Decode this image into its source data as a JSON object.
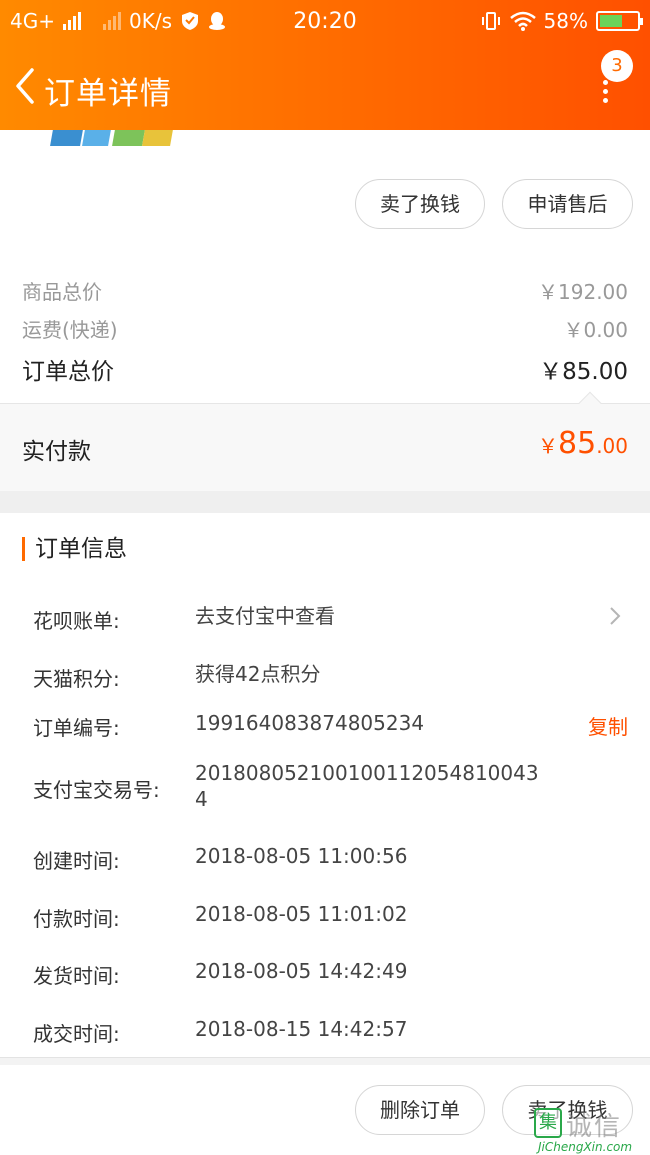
{
  "status_bar": {
    "network": "4G+",
    "speed": "0K/s",
    "time": "20:20",
    "battery": "58%"
  },
  "nav": {
    "title": "订单详情",
    "badge_count": "3"
  },
  "product_actions": {
    "sell_label": "卖了换钱",
    "after_sale_label": "申请售后"
  },
  "price_summary": {
    "goods_total_label": "商品总价",
    "goods_total_value": "￥192.00",
    "shipping_label": "运费(快递)",
    "shipping_value": "￥0.00",
    "order_total_label": "订单总价",
    "order_total_value": "￥85.00",
    "paid_label": "实付款",
    "paid_currency": "￥",
    "paid_integer": "85",
    "paid_decimal": ".00"
  },
  "order_info": {
    "title": "订单信息",
    "huabei_label": "花呗账单:",
    "huabei_value": "去支付宝中查看",
    "points_label": "天猫积分:",
    "points_value": "获得42点积分",
    "order_no_label": "订单编号:",
    "order_no_value": "199164083874805234",
    "copy_label": "复制",
    "alipay_no_label": "支付宝交易号:",
    "alipay_no_value": "2018080521001001120548100434",
    "created_label": "创建时间:",
    "created_value": "2018-08-05 11:00:56",
    "paid_time_label": "付款时间:",
    "paid_time_value": "2018-08-05 11:01:02",
    "shipped_label": "发货时间:",
    "shipped_value": "2018-08-05 14:42:49",
    "completed_label": "成交时间:",
    "completed_value": "2018-08-15 14:42:57"
  },
  "bottom_bar": {
    "delete_label": "删除订单",
    "sell_label": "卖了换钱"
  },
  "watermark": {
    "logo_char": "集",
    "cn": "诚信",
    "en": "JiChengXin.com"
  },
  "colors": {
    "accent": "#ff5000",
    "header_start": "#ff8a00",
    "header_end": "#ff5000"
  }
}
